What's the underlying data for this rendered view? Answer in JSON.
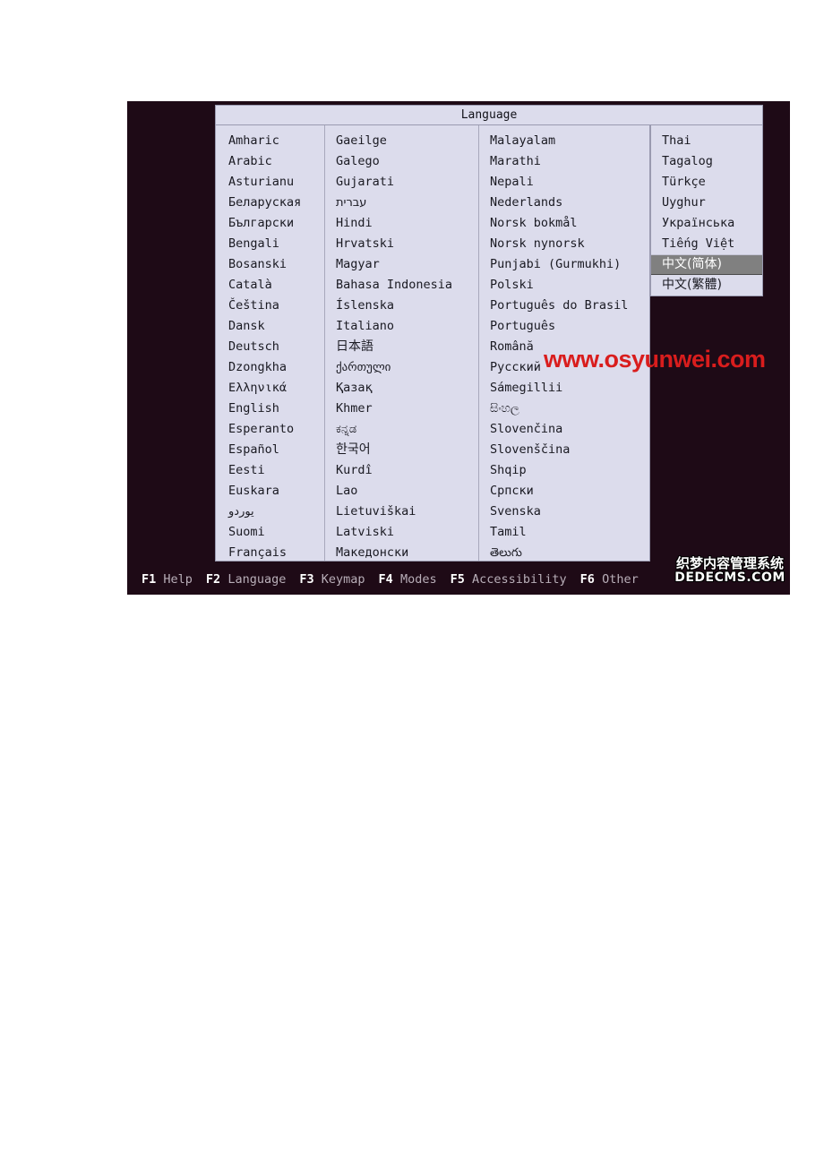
{
  "console": {
    "dialog_title": "Language",
    "columns": [
      {
        "name": "column-1",
        "items": [
          {
            "label": "Amharic",
            "script": "latin"
          },
          {
            "label": "Arabic",
            "script": "latin"
          },
          {
            "label": "Asturianu",
            "script": "latin"
          },
          {
            "label": "Беларуская",
            "script": "cyrillic"
          },
          {
            "label": "Български",
            "script": "cyrillic"
          },
          {
            "label": "Bengali",
            "script": "latin"
          },
          {
            "label": "Bosanski",
            "script": "latin"
          },
          {
            "label": "Català",
            "script": "latin"
          },
          {
            "label": "Čeština",
            "script": "latin"
          },
          {
            "label": "Dansk",
            "script": "latin"
          },
          {
            "label": "Deutsch",
            "script": "latin"
          },
          {
            "label": "Dzongkha",
            "script": "latin"
          },
          {
            "label": "Ελληνικά",
            "script": "greek"
          },
          {
            "label": "English",
            "script": "latin"
          },
          {
            "label": "Esperanto",
            "script": "latin"
          },
          {
            "label": "Español",
            "script": "latin"
          },
          {
            "label": "Eesti",
            "script": "latin"
          },
          {
            "label": "Euskara",
            "script": "latin"
          },
          {
            "label": "یوردو",
            "script": "arabic"
          },
          {
            "label": "Suomi",
            "script": "latin"
          },
          {
            "label": "Français",
            "script": "latin"
          }
        ]
      },
      {
        "name": "column-2",
        "items": [
          {
            "label": "Gaeilge",
            "script": "latin"
          },
          {
            "label": "Galego",
            "script": "latin"
          },
          {
            "label": "Gujarati",
            "script": "latin"
          },
          {
            "label": "עברית",
            "script": "hebrew"
          },
          {
            "label": "Hindi",
            "script": "latin"
          },
          {
            "label": "Hrvatski",
            "script": "latin"
          },
          {
            "label": "Magyar",
            "script": "latin"
          },
          {
            "label": "Bahasa Indonesia",
            "script": "latin"
          },
          {
            "label": "Íslenska",
            "script": "latin"
          },
          {
            "label": "Italiano",
            "script": "latin"
          },
          {
            "label": "日本語",
            "script": "cjk"
          },
          {
            "label": "ქართული",
            "script": "georgian"
          },
          {
            "label": "Қазақ",
            "script": "cyrillic"
          },
          {
            "label": "Khmer",
            "script": "latin"
          },
          {
            "label": "ಕನ್ನಡ",
            "script": "kannada"
          },
          {
            "label": "한국어",
            "script": "cjk"
          },
          {
            "label": "Kurdî",
            "script": "latin"
          },
          {
            "label": "Lao",
            "script": "latin"
          },
          {
            "label": "Lietuviškai",
            "script": "latin"
          },
          {
            "label": "Latviski",
            "script": "latin"
          },
          {
            "label": "Македонски",
            "script": "cyrillic"
          }
        ]
      },
      {
        "name": "column-3",
        "items": [
          {
            "label": "Malayalam",
            "script": "latin"
          },
          {
            "label": "Marathi",
            "script": "latin"
          },
          {
            "label": "Nepali",
            "script": "latin"
          },
          {
            "label": "Nederlands",
            "script": "latin"
          },
          {
            "label": "Norsk bokmål",
            "script": "latin"
          },
          {
            "label": "Norsk nynorsk",
            "script": "latin"
          },
          {
            "label": "Punjabi (Gurmukhi)",
            "script": "latin"
          },
          {
            "label": "Polski",
            "script": "latin"
          },
          {
            "label": "Português do Brasil",
            "script": "latin"
          },
          {
            "label": "Português",
            "script": "latin"
          },
          {
            "label": "Română",
            "script": "latin"
          },
          {
            "label": "Русский",
            "script": "cyrillic"
          },
          {
            "label": "Sámegillii",
            "script": "latin"
          },
          {
            "label": "සිංහල",
            "script": "sinhala"
          },
          {
            "label": "Slovenčina",
            "script": "latin"
          },
          {
            "label": "Slovenščina",
            "script": "latin"
          },
          {
            "label": "Shqip",
            "script": "latin"
          },
          {
            "label": "Српски",
            "script": "cyrillic"
          },
          {
            "label": "Svenska",
            "script": "latin"
          },
          {
            "label": "Tamil",
            "script": "latin"
          },
          {
            "label": "తెలుగు",
            "script": "telugu"
          }
        ]
      },
      {
        "name": "column-4",
        "items": [
          {
            "label": "Thai",
            "script": "latin",
            "selected": false
          },
          {
            "label": "Tagalog",
            "script": "latin",
            "selected": false
          },
          {
            "label": "Türkçe",
            "script": "latin",
            "selected": false
          },
          {
            "label": "Uyghur",
            "script": "latin",
            "selected": false
          },
          {
            "label": "Українська",
            "script": "cyrillic",
            "selected": false
          },
          {
            "label": "Tiếng Việt",
            "script": "latin",
            "selected": false
          },
          {
            "label": "中文(简体)",
            "script": "cjk",
            "selected": true
          },
          {
            "label": "中文(繁體)",
            "script": "cjk",
            "selected": false
          }
        ]
      }
    ],
    "function_keys": [
      {
        "key": "F1",
        "label": "Help"
      },
      {
        "key": "F2",
        "label": "Language"
      },
      {
        "key": "F3",
        "label": "Keymap"
      },
      {
        "key": "F4",
        "label": "Modes"
      },
      {
        "key": "F5",
        "label": "Accessibility"
      },
      {
        "key": "F6",
        "label": "Other"
      }
    ]
  },
  "watermarks": {
    "url": "www.osyunwei.com",
    "dedecms_cn": "织梦内容管理系统",
    "dedecms_en": "DEDECMS.COM"
  },
  "colors": {
    "console_background": "#1e0a16",
    "dialog_background": "#dcdcec",
    "dialog_border": "#9a9ab0",
    "text": "#1a1a22",
    "selection_background": "#808080",
    "selection_text": "#ffffff",
    "function_key": "#ffffff",
    "function_label": "#b8aeb8",
    "watermark_url": "#d91d1d"
  }
}
